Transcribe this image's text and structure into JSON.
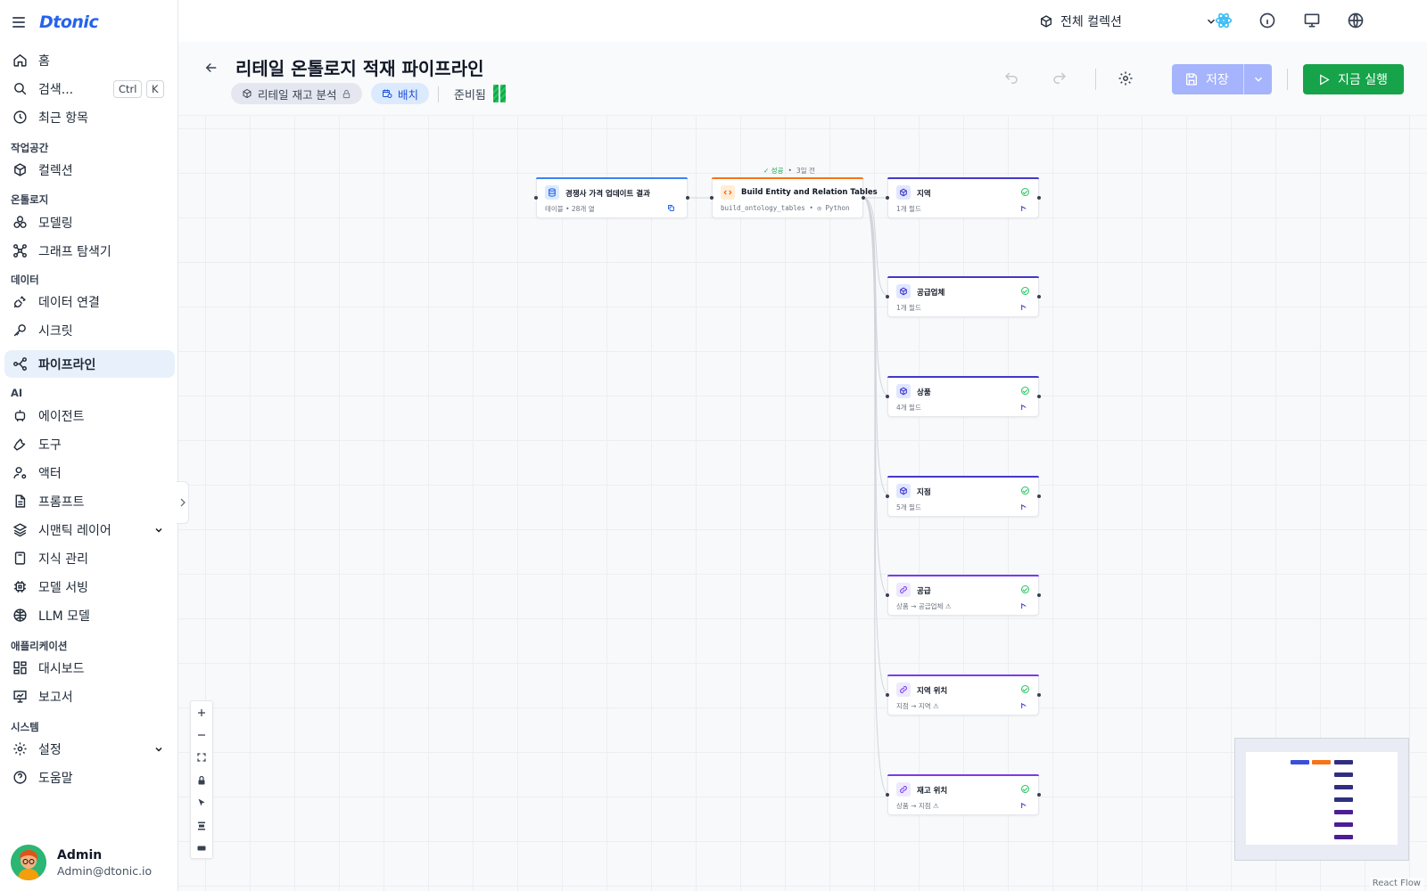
{
  "app": {
    "logo": "Dtonic"
  },
  "sidebar": {
    "home": "홈",
    "search": "검색...",
    "search_kbd_ctrl": "Ctrl",
    "search_kbd_k": "K",
    "recent": "최근 항목",
    "sections": {
      "workspace": "작업공간",
      "ontology": "온톨로지",
      "data": "데이터",
      "ai": "AI",
      "apps": "애플리케이션",
      "system": "시스템"
    },
    "items": {
      "collection": "컬렉션",
      "modeling": "모델링",
      "graph": "그래프 탐색기",
      "dataconn": "데이터 연결",
      "secret": "시크릿",
      "pipeline": "파이프라인",
      "agent": "에이전트",
      "tool": "도구",
      "actor": "액터",
      "prompt": "프롬프트",
      "semantic": "시맨틱 레이어",
      "knowledge": "지식 관리",
      "serving": "모델 서빙",
      "llm": "LLM 모델",
      "dashboard": "대시보드",
      "report": "보고서",
      "settings": "설정",
      "help": "도움말"
    },
    "user": {
      "name": "Admin",
      "email": "Admin@dtonic.io"
    }
  },
  "topbar": {
    "collection_select": "전체 컬렉션"
  },
  "header": {
    "title": "리테일 온톨로지 적재 파이프라인",
    "collection_chip": "리테일 재고 분석",
    "mode_chip": "배치",
    "status": "준비됨",
    "save": "저장",
    "run": "지금 실행"
  },
  "canvas": {
    "run_status": {
      "label": "성공",
      "time": "3일 전"
    },
    "source_node": {
      "title": "경쟁사 가격 업데이트 결과",
      "sub": "테이블 • 28개 열"
    },
    "transform_node": {
      "title": "Build Entity and Relation Tables",
      "sub": "build_ontology_tables • ◎ Python"
    },
    "outputs": [
      {
        "title": "지역",
        "sub": "1개 필드",
        "kind": "entity"
      },
      {
        "title": "공급업체",
        "sub": "1개 필드",
        "kind": "entity"
      },
      {
        "title": "상품",
        "sub": "4개 필드",
        "kind": "entity"
      },
      {
        "title": "지점",
        "sub": "5개 필드",
        "kind": "entity"
      },
      {
        "title": "공급",
        "sub": "상품 → 공급업체 ⚠",
        "kind": "relation"
      },
      {
        "title": "지역 위치",
        "sub": "지점 → 지역 ⚠",
        "kind": "relation"
      },
      {
        "title": "재고 위치",
        "sub": "상품 → 지점 ⚠",
        "kind": "relation"
      }
    ],
    "attribution": "React Flow"
  },
  "colors": {
    "accent_blue": "#2563eb",
    "source_accent": "#3b82f6",
    "transform_accent": "#f97316",
    "entity_accent": "#4338ca",
    "relation_accent": "#7c3aed",
    "run_green": "#16a34a",
    "save_disabled": "#a5b4fc"
  }
}
